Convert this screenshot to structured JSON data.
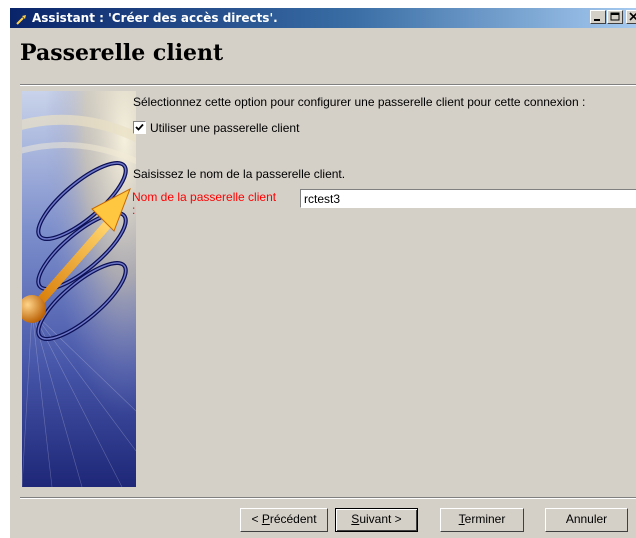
{
  "window": {
    "title": "Assistant : 'Créer des accès directs'."
  },
  "page": {
    "title": "Passerelle client"
  },
  "content": {
    "option_instruction": "Sélectionnez cette option pour configurer une passerelle client pour cette connexion :",
    "checkbox": {
      "label": "Utiliser une passerelle client",
      "checked": true
    },
    "name_instruction": "Saisissez le nom de la passerelle client.",
    "field": {
      "label": "Nom de la passerelle client",
      "label_suffix": ":",
      "value": "rctest3"
    }
  },
  "buttons": {
    "previous": {
      "prefix": "< ",
      "mnemonic": "P",
      "rest": "récédent"
    },
    "next": {
      "mnemonic": "S",
      "rest": "uivant >"
    },
    "finish": {
      "mnemonic": "T",
      "rest": "erminer"
    },
    "cancel": {
      "label": "Annuler"
    }
  },
  "colors": {
    "titlebar_start": "#0a246a",
    "titlebar_end": "#a6caf0",
    "dialog_background": "#d4d0c8",
    "field_label": "#ff0000"
  }
}
